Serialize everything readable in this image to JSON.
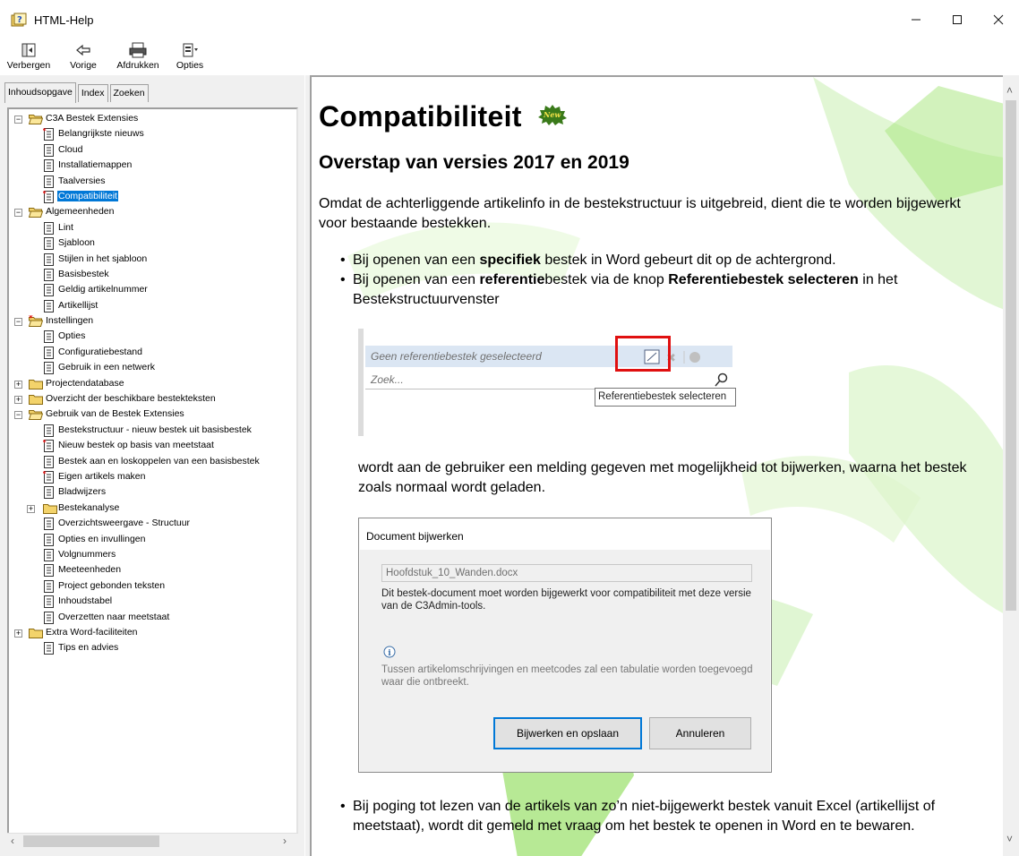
{
  "window": {
    "title": "HTML-Help",
    "minimize": "–",
    "maximize": "☐",
    "close": "✕"
  },
  "toolbar": {
    "hide": "Verbergen",
    "back": "Vorige",
    "print": "Afdrukken",
    "options": "Opties"
  },
  "tabs": [
    "Inhoudsopgave",
    "Index",
    "Zoeken"
  ],
  "tree": [
    {
      "label": "C3A Bestek Extensies",
      "level": 0,
      "type": "open-folder",
      "exp": "−"
    },
    {
      "label": "Belangrijkste nieuws",
      "level": 1,
      "type": "new-page"
    },
    {
      "label": "Cloud",
      "level": 1,
      "type": "page"
    },
    {
      "label": "Installatiemappen",
      "level": 1,
      "type": "page"
    },
    {
      "label": "Taalversies",
      "level": 1,
      "type": "page"
    },
    {
      "label": "Compatibiliteit",
      "level": 1,
      "type": "new-page",
      "selected": true
    },
    {
      "label": "Algemeenheden",
      "level": 0,
      "type": "open-folder",
      "exp": "−"
    },
    {
      "label": "Lint",
      "level": 1,
      "type": "page"
    },
    {
      "label": "Sjabloon",
      "level": 1,
      "type": "page"
    },
    {
      "label": "Stijlen in het sjabloon",
      "level": 1,
      "type": "page"
    },
    {
      "label": "Basisbestek",
      "level": 1,
      "type": "page"
    },
    {
      "label": "Geldig artikelnummer",
      "level": 1,
      "type": "page"
    },
    {
      "label": "Artikellijst",
      "level": 1,
      "type": "page"
    },
    {
      "label": "Instellingen",
      "level": 0,
      "type": "new-folder",
      "exp": "−"
    },
    {
      "label": "Opties",
      "level": 1,
      "type": "page"
    },
    {
      "label": "Configuratiebestand",
      "level": 1,
      "type": "page"
    },
    {
      "label": "Gebruik in een netwerk",
      "level": 1,
      "type": "page"
    },
    {
      "label": "Projectendatabase",
      "level": 0,
      "type": "folder",
      "exp": "+"
    },
    {
      "label": "Overzicht der beschikbare bestekteksten",
      "level": 0,
      "type": "folder",
      "exp": "+"
    },
    {
      "label": "Gebruik van de Bestek Extensies",
      "level": 0,
      "type": "open-folder",
      "exp": "−"
    },
    {
      "label": "Bestekstructuur - nieuw bestek uit basisbestek",
      "level": 1,
      "type": "page"
    },
    {
      "label": "Nieuw bestek op basis van meetstaat",
      "level": 1,
      "type": "new-page"
    },
    {
      "label": "Bestek aan en loskoppelen van een basisbestek",
      "level": 1,
      "type": "page"
    },
    {
      "label": "Eigen artikels maken",
      "level": 1,
      "type": "new-page"
    },
    {
      "label": "Bladwijzers",
      "level": 1,
      "type": "page"
    },
    {
      "label": "Bestekanalyse",
      "level": 1,
      "type": "folder",
      "exp": "+"
    },
    {
      "label": "Overzichtsweergave - Structuur",
      "level": 1,
      "type": "page"
    },
    {
      "label": "Opties en invullingen",
      "level": 1,
      "type": "page"
    },
    {
      "label": "Volgnummers",
      "level": 1,
      "type": "page"
    },
    {
      "label": "Meeteenheden",
      "level": 1,
      "type": "page"
    },
    {
      "label": "Project gebonden teksten",
      "level": 1,
      "type": "page"
    },
    {
      "label": "Inhoudstabel",
      "level": 1,
      "type": "page"
    },
    {
      "label": "Overzetten naar meetstaat",
      "level": 1,
      "type": "page"
    },
    {
      "label": "Extra Word-faciliteiten",
      "level": 0,
      "type": "folder",
      "exp": "+"
    },
    {
      "label": "Tips en advies",
      "level": 0,
      "type": "page-root"
    }
  ],
  "content": {
    "title": "Compatibiliteit",
    "badge": "New",
    "subtitle": "Overstap van versies 2017 en 2019",
    "intro": "Omdat de achterliggende artikelinfo in de bestekstructuur is uitgebreid, dient die te worden bijgewerkt voor bestaande bestekken.",
    "bullet1_pre": "Bij openen van een ",
    "bullet1_bold": "specifiek",
    "bullet1_post": " bestek in Word gebeurt dit op de achtergrond.",
    "bullet2_pre": "Bij openen van een ",
    "bullet2_bold": "referentie",
    "bullet2_mid": "bestek via de knop ",
    "bullet2_bold2": "Referentiebestek selecteren",
    "bullet2_post": " in het Bestekstructuurvenster",
    "shot1": {
      "placeholder": "Geen referentiebestek geselecteerd",
      "search": "Zoek...",
      "tooltip": "Referentiebestek selecteren"
    },
    "after_shot": "wordt aan de gebruiker een melding gegeven met mogelijkheid tot bijwerken, waarna het bestek zoals normaal wordt geladen.",
    "dialog": {
      "title": "Document bijwerken",
      "file": "Hoofdstuk_10_Wanden.docx",
      "message": "Dit bestek-document moet worden bijgewerkt voor compatibiliteit met deze versie van de C3Admin-tools.",
      "note": "Tussen artikelomschrijvingen en meetcodes zal een tabulatie worden toegevoegd waar die ontbreekt.",
      "primary": "Bijwerken en opslaan",
      "secondary": "Annuleren"
    },
    "bullet3": "Bij poging tot lezen van de artikels van zo’n niet-bijgewerkt bestek vanuit Excel (artikellijst of meetstaat), wordt dit gemeld met vraag om het bestek te openen in Word en te bewaren."
  },
  "colors": {
    "selection": "#0078d7",
    "accent_green": "#8dd94a",
    "highlight_red": "#e01010"
  }
}
